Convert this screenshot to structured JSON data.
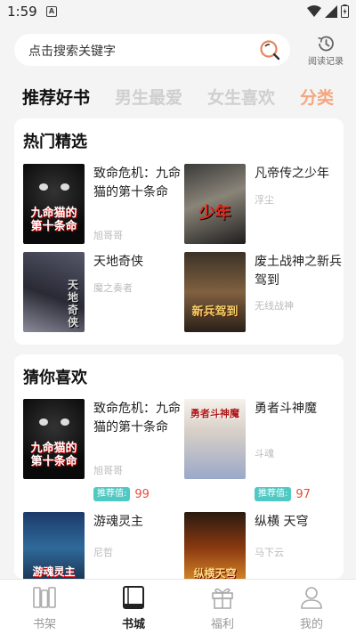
{
  "status_bar": {
    "time": "1:59",
    "notification_letter": "A"
  },
  "search": {
    "placeholder": "点击搜索关键字",
    "history_label": "阅读记录"
  },
  "tabs": [
    {
      "label": "推荐好书",
      "state": "active"
    },
    {
      "label": "男生最爱",
      "state": "inactive"
    },
    {
      "label": "女生喜欢",
      "state": "inactive"
    },
    {
      "label": "分类",
      "state": "accent"
    }
  ],
  "hot": {
    "title": "热门精选",
    "books": [
      {
        "title": "致命危机：九命猫的第十条命",
        "author": "旭哥哥",
        "cover_text": "九命猫的第十条命",
        "cover_style": "cat"
      },
      {
        "title": "凡帝传之少年",
        "author": "浮尘",
        "cover_text": "少年",
        "cover_style": "dragon"
      },
      {
        "title": "天地奇侠",
        "author": "魔之奏者",
        "cover_text": "天地奇侠",
        "cover_style": "warrior"
      },
      {
        "title": "废土战神之新兵驾到",
        "author": "无线战神",
        "cover_text": "新兵驾到",
        "cover_style": "soldier"
      }
    ]
  },
  "guess": {
    "title": "猜你喜欢",
    "recommend_label": "推荐值:",
    "books": [
      {
        "title": "致命危机：九命猫的第十条命",
        "author": "旭哥哥",
        "score": "99",
        "cover_text": "九命猫的第十条命",
        "cover_style": "cat"
      },
      {
        "title": "勇者斗神魔",
        "author": "斗魂",
        "score": "97",
        "cover_text": "勇者斗神魔",
        "cover_style": "hero"
      },
      {
        "title": "游魂灵主",
        "author": "尼哲",
        "cover_text": "游魂灵主",
        "cover_style": "soul"
      },
      {
        "title": "纵横 天穹",
        "author": "马下云",
        "cover_text": "纵横天穹",
        "cover_style": "sky"
      }
    ]
  },
  "bottom_nav": [
    {
      "label": "书架",
      "icon": "bookshelf-icon",
      "active": false
    },
    {
      "label": "书城",
      "icon": "bookstore-icon",
      "active": true
    },
    {
      "label": "福利",
      "icon": "gift-icon",
      "active": false
    },
    {
      "label": "我的",
      "icon": "profile-icon",
      "active": false
    }
  ],
  "colors": {
    "accent": "#f5a77e",
    "badge": "#4fc9c4",
    "score": "#e74c3c"
  }
}
